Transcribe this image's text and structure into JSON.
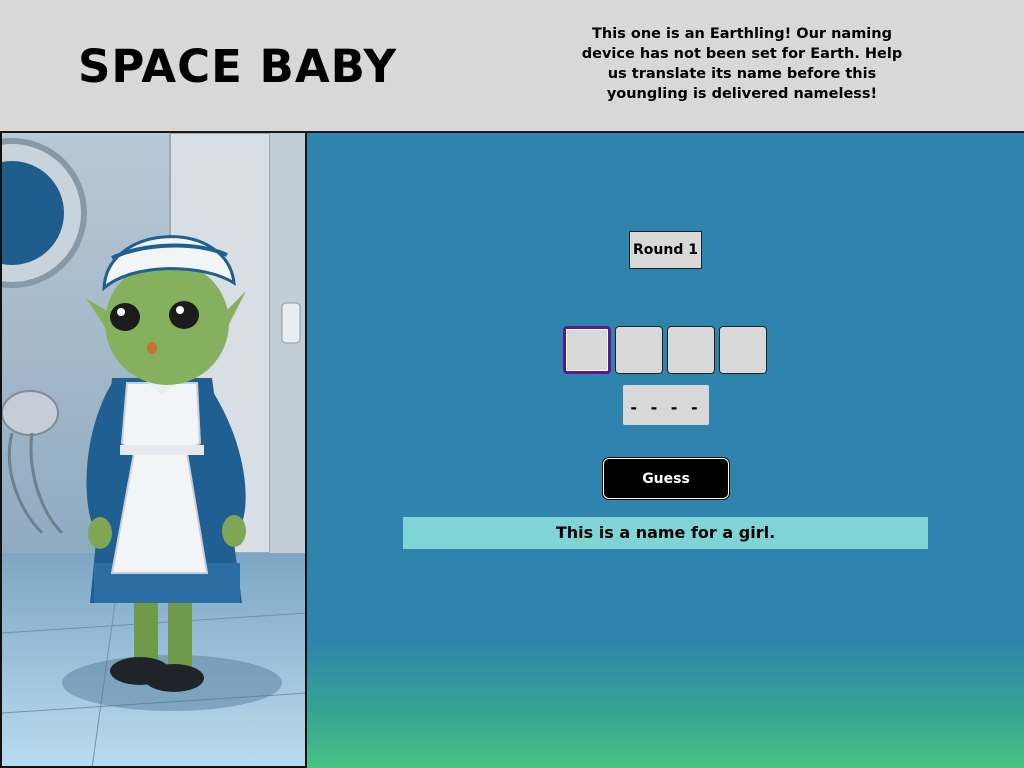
{
  "header": {
    "title": "SPACE BABY",
    "intro": "This one is an Earthling! Our naming device has not been set for Earth. Help us translate its name before this youngling is delivered nameless!"
  },
  "portrait": {
    "alt": "Green alien girl in a blue maid dress and white apron standing in a spaceship corridor"
  },
  "game": {
    "round_label": "Round 1",
    "letters": [
      "",
      "",
      "",
      ""
    ],
    "pattern": "- - - -",
    "guess_label": "Guess",
    "hint": "This is a name for a girl."
  },
  "colors": {
    "game_bg": "#2e84ad",
    "hint_bg": "#7fd4d6",
    "active_box_border": "#5a1a8c"
  }
}
